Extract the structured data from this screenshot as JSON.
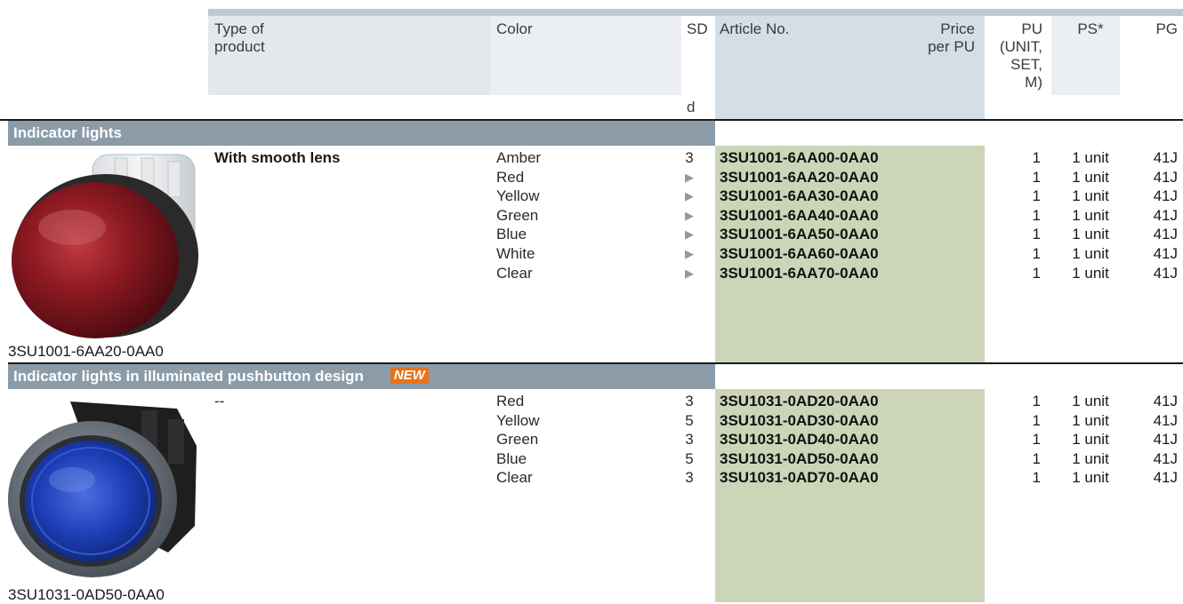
{
  "header": {
    "type_of_product": [
      "Type of",
      "product"
    ],
    "color": "Color",
    "sd": "SD",
    "sd_unit": "d",
    "article_no": "Article No.",
    "price": [
      "Price",
      "per PU"
    ],
    "pu": [
      "PU",
      "(UNIT,",
      "SET,",
      "M)"
    ],
    "ps": "PS*",
    "pg": "PG"
  },
  "sections": [
    {
      "title": "Indicator lights",
      "type": "With smooth lens",
      "image_caption": "3SU1001-6AA20-0AA0",
      "rows": [
        {
          "color": "Amber",
          "sd": "3",
          "article": "3SU1001-6AA00-0AA0",
          "pu": "1",
          "ps": "1 unit",
          "pg": "41J"
        },
        {
          "color": "Red",
          "sd": "▶",
          "article": "3SU1001-6AA20-0AA0",
          "pu": "1",
          "ps": "1 unit",
          "pg": "41J"
        },
        {
          "color": "Yellow",
          "sd": "▶",
          "article": "3SU1001-6AA30-0AA0",
          "pu": "1",
          "ps": "1 unit",
          "pg": "41J"
        },
        {
          "color": "Green",
          "sd": "▶",
          "article": "3SU1001-6AA40-0AA0",
          "pu": "1",
          "ps": "1 unit",
          "pg": "41J"
        },
        {
          "color": "Blue",
          "sd": "▶",
          "article": "3SU1001-6AA50-0AA0",
          "pu": "1",
          "ps": "1 unit",
          "pg": "41J"
        },
        {
          "color": "White",
          "sd": "▶",
          "article": "3SU1001-6AA60-0AA0",
          "pu": "1",
          "ps": "1 unit",
          "pg": "41J"
        },
        {
          "color": "Clear",
          "sd": "▶",
          "article": "3SU1001-6AA70-0AA0",
          "pu": "1",
          "ps": "1 unit",
          "pg": "41J"
        }
      ]
    },
    {
      "title": "Indicator lights in illuminated pushbutton design",
      "badge": "NEW",
      "type": "--",
      "image_caption": "3SU1031-0AD50-0AA0",
      "rows": [
        {
          "color": "Red",
          "sd": "3",
          "article": "3SU1031-0AD20-0AA0",
          "pu": "1",
          "ps": "1 unit",
          "pg": "41J"
        },
        {
          "color": "Yellow",
          "sd": "5",
          "article": "3SU1031-0AD30-0AA0",
          "pu": "1",
          "ps": "1 unit",
          "pg": "41J"
        },
        {
          "color": "Green",
          "sd": "3",
          "article": "3SU1031-0AD40-0AA0",
          "pu": "1",
          "ps": "1 unit",
          "pg": "41J"
        },
        {
          "color": "Blue",
          "sd": "5",
          "article": "3SU1031-0AD50-0AA0",
          "pu": "1",
          "ps": "1 unit",
          "pg": "41J"
        },
        {
          "color": "Clear",
          "sd": "3",
          "article": "3SU1031-0AD70-0AA0",
          "pu": "1",
          "ps": "1 unit",
          "pg": "41J"
        }
      ]
    }
  ],
  "colors": {
    "section_bar": "#8b9ba8",
    "article_column": "#ccd5b8",
    "header_article": "#d4dee7",
    "new_badge": "#e8731a",
    "sd_triangle": "#8d9aa8"
  }
}
